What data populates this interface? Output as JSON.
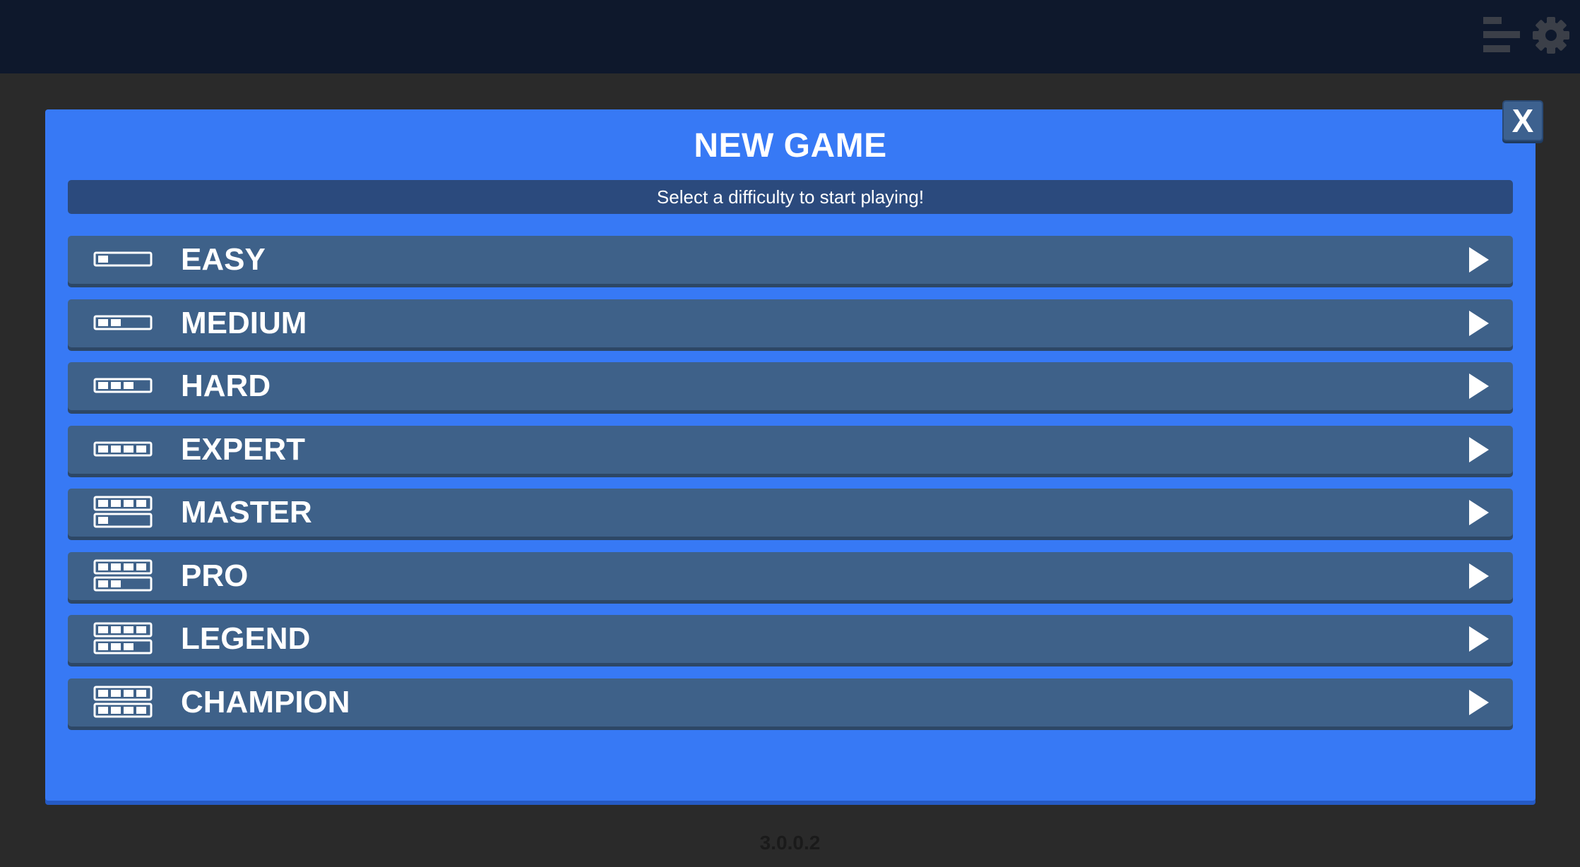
{
  "topbar": {
    "stats_icon": "leaderboard-icon",
    "settings_icon": "gear-icon"
  },
  "modal": {
    "title": "NEW GAME",
    "subtitle": "Select a difficulty to start playing!",
    "close_label": "X",
    "difficulties": [
      {
        "label": "EASY",
        "bars_row1": 1,
        "bars_row2": 0
      },
      {
        "label": "MEDIUM",
        "bars_row1": 2,
        "bars_row2": 0
      },
      {
        "label": "HARD",
        "bars_row1": 3,
        "bars_row2": 0
      },
      {
        "label": "EXPERT",
        "bars_row1": 4,
        "bars_row2": 0
      },
      {
        "label": "MASTER",
        "bars_row1": 4,
        "bars_row2": 1
      },
      {
        "label": "PRO",
        "bars_row1": 4,
        "bars_row2": 2
      },
      {
        "label": "LEGEND",
        "bars_row1": 4,
        "bars_row2": 3
      },
      {
        "label": "CHAMPION",
        "bars_row1": 4,
        "bars_row2": 4
      }
    ],
    "play_icon": "play-arrow-icon"
  },
  "version": "3.0.0.2",
  "colors": {
    "topbar": "#0e182c",
    "background": "#2a2a2a",
    "modal": "#3779f5",
    "subtitle_bar": "#2b4a7d",
    "row": "#3e6189",
    "close_button": "#3d618f"
  }
}
